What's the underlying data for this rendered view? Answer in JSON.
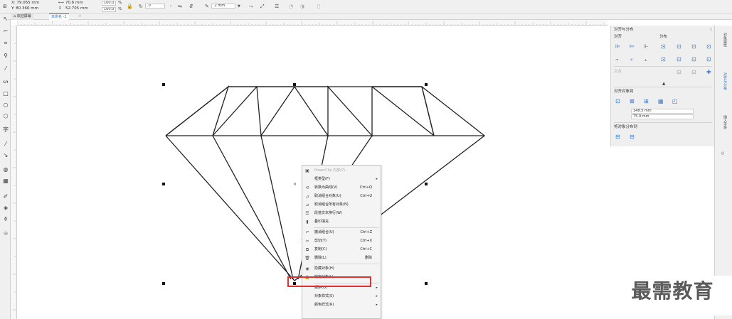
{
  "property_bar": {
    "x": "X: 79.065 mm",
    "y": "Y: 80.366 mm",
    "width": "70.6 mm",
    "height": "52.705 mm",
    "scale_w": "100.0",
    "scale_h": "100.0",
    "percent": "%",
    "rotation": ".0",
    "outline_width": ".2 mm"
  },
  "tabs": {
    "welcome": "欢迎屏幕",
    "document": "未命名 -1"
  },
  "context_menu": {
    "items": [
      {
        "icon": "powerclip-icon",
        "label": "PowerClip 内部(P)...",
        "shortcut": "",
        "submenu": false,
        "disabled": true
      },
      {
        "icon": "",
        "label": "框类型(F)",
        "shortcut": "",
        "submenu": true,
        "disabled": false
      },
      {
        "icon": "convert-curve-icon",
        "label": "转换为曲线(V)",
        "shortcut": "Ctrl+Q",
        "submenu": false,
        "disabled": false
      },
      {
        "icon": "ungroup-icon",
        "label": "取消组合对象(U)",
        "shortcut": "Ctrl+U",
        "submenu": false,
        "disabled": false
      },
      {
        "icon": "ungroup-all-icon",
        "label": "取消组合所有对象(N)",
        "shortcut": "",
        "submenu": false,
        "disabled": false
      },
      {
        "icon": "wrap-text-icon",
        "label": "段落文本换行(W)",
        "shortcut": "",
        "submenu": false,
        "disabled": false
      },
      {
        "icon": "overprint-icon",
        "label": "叠印填充",
        "shortcut": "",
        "submenu": false,
        "disabled": false
      },
      {
        "icon": "undo-icon",
        "label": "撤消组合(U)",
        "shortcut": "Ctrl+Z",
        "submenu": false,
        "disabled": false
      },
      {
        "icon": "cut-icon",
        "label": "剪切(T)",
        "shortcut": "Ctrl+X",
        "submenu": false,
        "disabled": false
      },
      {
        "icon": "copy-icon",
        "label": "复制(C)",
        "shortcut": "Ctrl+C",
        "submenu": false,
        "disabled": false
      },
      {
        "icon": "delete-icon",
        "label": "删除(L)",
        "shortcut": "删除",
        "submenu": false,
        "disabled": false
      },
      {
        "icon": "hide-icon",
        "label": "隐藏对象(H)",
        "shortcut": "",
        "submenu": false,
        "disabled": false
      },
      {
        "icon": "lock-icon",
        "label": "锁定对象(L)",
        "shortcut": "",
        "submenu": false,
        "disabled": false
      },
      {
        "icon": "",
        "label": "顺序(O)",
        "shortcut": "",
        "submenu": true,
        "disabled": false
      },
      {
        "icon": "",
        "label": "对象样式(S)",
        "shortcut": "",
        "submenu": true,
        "disabled": false
      },
      {
        "icon": "",
        "label": "颜色样式(R)",
        "shortcut": "",
        "submenu": true,
        "disabled": false
      }
    ]
  },
  "docker": {
    "title": "对齐与分布",
    "align_label": "对齐",
    "distribute_label": "分布",
    "text_label": "文本",
    "align_to_label": "对齐对象到",
    "x_value": "148.5 mm",
    "y_value": "75.0 mm",
    "distribute_to_label": "将对象分布到"
  },
  "side_tabs": {
    "properties": "对象属性",
    "align": "对齐与分布",
    "insert_char": "插入字符"
  },
  "watermark": "最需教育",
  "colors": {
    "highlight": "#e03030",
    "accent": "#2f6fc2",
    "panel_bg": "#efefef"
  }
}
